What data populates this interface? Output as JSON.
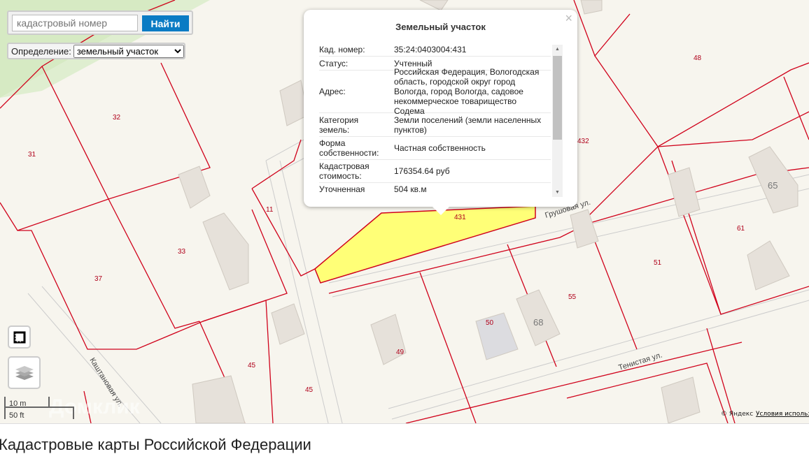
{
  "search": {
    "placeholder": "кадастровый номер",
    "button": "Найти"
  },
  "definition": {
    "label": "Определение:",
    "selected": "земельный участок"
  },
  "popup": {
    "title": "Земельный участок",
    "close": "×",
    "rows": [
      {
        "key": "Кад. номер:",
        "value": "35:24:0403004:431"
      },
      {
        "key": "Статус:",
        "value": "Учтенный"
      },
      {
        "key": "Адрес:",
        "value": "Российская Федерация, Вологодская область, городской округ город Вологда, город Вологда, садовое некоммерческое товарищество Содема"
      },
      {
        "key": "Категория земель:",
        "value": "Земли поселений (земли населенных пунктов)"
      },
      {
        "key": "Форма собственности:",
        "value": "Частная собственность"
      },
      {
        "key": "Кадастровая стоимость:",
        "value": "176354.64 руб"
      },
      {
        "key": "Уточненная площадь:",
        "value": "504 кв.м"
      }
    ]
  },
  "map": {
    "parcels": [
      "31",
      "32",
      "33",
      "37",
      "11",
      "45",
      "45",
      "49",
      "50",
      "68",
      "55",
      "51",
      "61",
      "65",
      "48",
      "432",
      "431"
    ],
    "streets": {
      "grushovaya": "Грушовая ул.",
      "tenistaya": "Тенистая ул.",
      "kashtanovaya": "Каштановая ул."
    },
    "scale": {
      "metric": "10 m",
      "imperial": "50 ft"
    },
    "watermark": "Домклик",
    "copyright": "© Яндекс",
    "terms": "Условия использования",
    "selected_color": "#ffff77",
    "border_color": "#d0021b"
  },
  "footer": {
    "title": "Кадастровые карты Российской Федерации"
  }
}
